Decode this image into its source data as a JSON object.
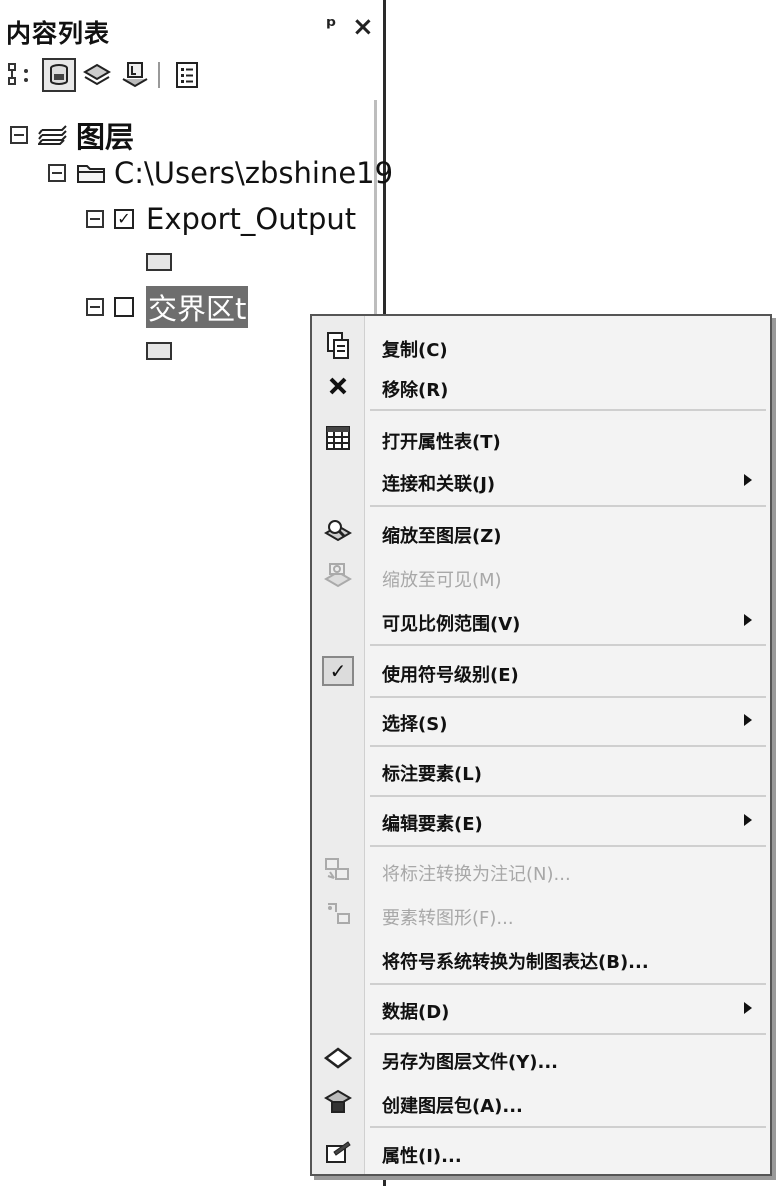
{
  "panel": {
    "title": "内容列表",
    "pin_glyph": "ᵖ",
    "close_glyph": "×"
  },
  "toolbar": {
    "buttons": [
      {
        "icon": "list-by-drawing-order-icon"
      },
      {
        "icon": "list-by-source-icon"
      },
      {
        "icon": "list-by-visibility-icon"
      },
      {
        "icon": "list-by-selection-icon"
      },
      {
        "icon": "options-icon"
      }
    ]
  },
  "tree": {
    "root": {
      "label": "图层"
    },
    "folder": {
      "label": "C:\\Users\\zbshine19"
    },
    "layer1": {
      "label": "Export_Output",
      "checked": true
    },
    "layer2": {
      "label": "交界区t",
      "checked": false
    }
  },
  "context_menu": {
    "items": [
      {
        "label": "复制(C)",
        "icon": "copy-icon",
        "enabled": true
      },
      {
        "label": "移除(R)",
        "icon": "remove-icon",
        "enabled": true
      },
      {
        "label": "打开属性表(T)",
        "icon": "table-icon",
        "enabled": true
      },
      {
        "label": "连接和关联(J)",
        "icon": "",
        "enabled": true,
        "submenu": true
      },
      {
        "label": "缩放至图层(Z)",
        "icon": "zoom-to-layer-icon",
        "enabled": true
      },
      {
        "label": "缩放至可见(M)",
        "icon": "zoom-to-visible-icon",
        "enabled": false
      },
      {
        "label": "可见比例范围(V)",
        "icon": "",
        "enabled": true,
        "submenu": true
      },
      {
        "label": "使用符号级别(E)",
        "icon": "checkmark-icon",
        "enabled": true,
        "checked": true
      },
      {
        "label": "选择(S)",
        "icon": "",
        "enabled": true,
        "submenu": true
      },
      {
        "label": "标注要素(L)",
        "icon": "",
        "enabled": true
      },
      {
        "label": "编辑要素(E)",
        "icon": "",
        "enabled": true,
        "submenu": true
      },
      {
        "label": "将标注转换为注记(N)...",
        "icon": "convert-labels-icon",
        "enabled": false
      },
      {
        "label": "要素转图形(F)...",
        "icon": "features-to-graphics-icon",
        "enabled": false
      },
      {
        "label": "将符号系统转换为制图表达(B)...",
        "icon": "",
        "enabled": true
      },
      {
        "label": "数据(D)",
        "icon": "",
        "enabled": true,
        "submenu": true
      },
      {
        "label": "另存为图层文件(Y)...",
        "icon": "layer-file-icon",
        "enabled": true
      },
      {
        "label": "创建图层包(A)...",
        "icon": "layer-package-icon",
        "enabled": true
      },
      {
        "label": "属性(I)...",
        "icon": "properties-icon",
        "enabled": true
      }
    ]
  }
}
